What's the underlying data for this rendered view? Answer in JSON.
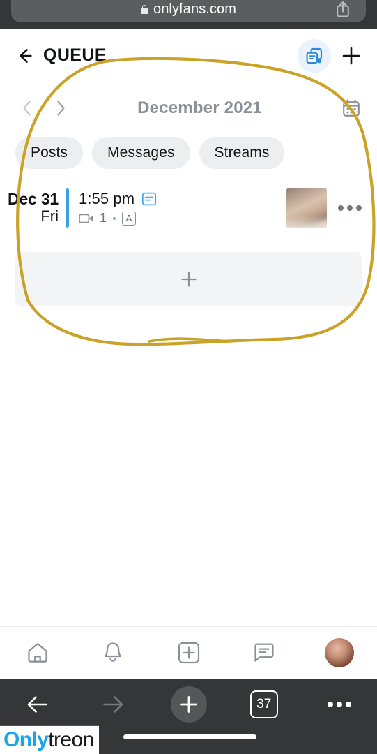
{
  "browser": {
    "url": "onlyfans.com",
    "lock_icon": "lock-icon",
    "share_icon": "share-icon",
    "back_icon": "browser-back-icon",
    "forward_icon": "browser-forward-icon",
    "new_tab_icon": "plus-icon",
    "tab_count": "37",
    "more_icon": "more-horizontal-icon",
    "chrome_bg": "#353638",
    "urlbar_bg": "#5b5d60"
  },
  "header": {
    "back_icon": "arrow-left-icon",
    "title": "QUEUE",
    "queue_icon": "queue-copy-icon",
    "add_icon": "plus-icon",
    "queue_icon_color": "#2c88da",
    "queue_icon_bg": "#eaf3fc"
  },
  "month_nav": {
    "prev_icon": "chevron-left-icon",
    "next_icon": "chevron-right-icon",
    "label": "December 2021",
    "calendar_icon": "calendar-icon",
    "label_color": "#8b9098"
  },
  "filters": [
    {
      "label": "Posts",
      "name": "filter-pill-posts"
    },
    {
      "label": "Messages",
      "name": "filter-pill-messages"
    },
    {
      "label": "Streams",
      "name": "filter-pill-streams"
    }
  ],
  "queue_items": [
    {
      "date_day": "Dec 31",
      "date_weekday": "Fri",
      "time": "1:55 pm",
      "post_type_icon": "post-text-icon",
      "media_icon": "video-camera-icon",
      "media_count": "1",
      "audience_badge": "A",
      "accent_color": "#36a4e8",
      "thumbnail": "post-thumbnail",
      "more_icon": "more-horizontal-icon"
    }
  ],
  "add_slot": {
    "icon": "plus-icon",
    "bg": "#f3f4f5"
  },
  "app_nav": [
    {
      "icon": "home-icon",
      "name": "nav-home"
    },
    {
      "icon": "bell-icon",
      "name": "nav-notifications"
    },
    {
      "icon": "add-box-icon",
      "name": "nav-create"
    },
    {
      "icon": "message-icon",
      "name": "nav-messages"
    },
    {
      "icon": "avatar",
      "name": "nav-profile"
    }
  ],
  "annotation": {
    "shape": "hand-drawn-ellipse",
    "color": "#c9a227"
  },
  "watermark": {
    "part1": "Only",
    "part2": "treon",
    "part1_color": "#1ba5e8",
    "part2_color": "#1a1a1a",
    "rule_color": "#8e2a68"
  }
}
